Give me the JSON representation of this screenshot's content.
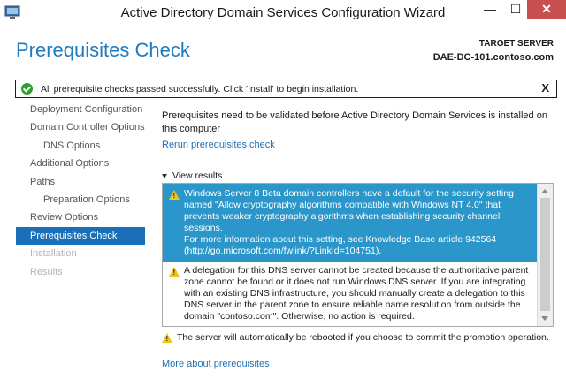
{
  "window": {
    "title": "Active Directory Domain Services Configuration Wizard",
    "minimize_glyph": "—",
    "maximize_glyph": "☐",
    "close_glyph": "✕"
  },
  "header": {
    "page_title": "Prerequisites Check",
    "target_label": "TARGET SERVER",
    "target_value": "DAE-DC-101.contoso.com"
  },
  "banner": {
    "message": "All prerequisite checks passed successfully.  Click 'Install' to begin installation.",
    "close_label": "X",
    "icon": "check-circle-icon",
    "icon_color": "#2f9e2f"
  },
  "sidebar": {
    "items": [
      {
        "label": "Deployment Configuration",
        "state": "normal"
      },
      {
        "label": "Domain Controller Options",
        "state": "normal"
      },
      {
        "label": "DNS Options",
        "state": "normal"
      },
      {
        "label": "Additional Options",
        "state": "normal"
      },
      {
        "label": "Paths",
        "state": "normal"
      },
      {
        "label": "Preparation Options",
        "state": "normal"
      },
      {
        "label": "Review Options",
        "state": "normal"
      },
      {
        "label": "Prerequisites Check",
        "state": "active"
      },
      {
        "label": "Installation",
        "state": "disabled"
      },
      {
        "label": "Results",
        "state": "disabled"
      }
    ],
    "active_color": "#1a70b8"
  },
  "main": {
    "intro": "Prerequisites need to be validated before Active Directory Domain Services is installed on this computer",
    "rerun_link": "Rerun prerequisites check",
    "view_results_label": "View results",
    "results": [
      {
        "icon": "warning-icon",
        "selected": true,
        "text": "Windows Server 8 Beta domain controllers have a default for the security setting named \"Allow cryptography algorithms compatible with Windows NT 4.0\" that prevents weaker cryptography algorithms when establishing security channel sessions.",
        "text2": "For more information about this setting, see Knowledge Base article 942564 (http://go.microsoft.com/fwlink/?LinkId=104751)."
      },
      {
        "icon": "warning-icon",
        "selected": false,
        "text": "A delegation for this DNS server cannot be created because the authoritative parent zone cannot be found or it does not run Windows DNS server. If you are integrating with an existing DNS infrastructure, you should manually create a delegation to this DNS server in the parent zone to ensure reliable name resolution from outside the domain \"contoso.com\". Otherwise, no action is required."
      }
    ],
    "selected_color": "#2b96c9",
    "reboot_warning": "The server will automatically be rebooted if you choose to commit the promotion operation.",
    "more_link": "More about prerequisites"
  }
}
